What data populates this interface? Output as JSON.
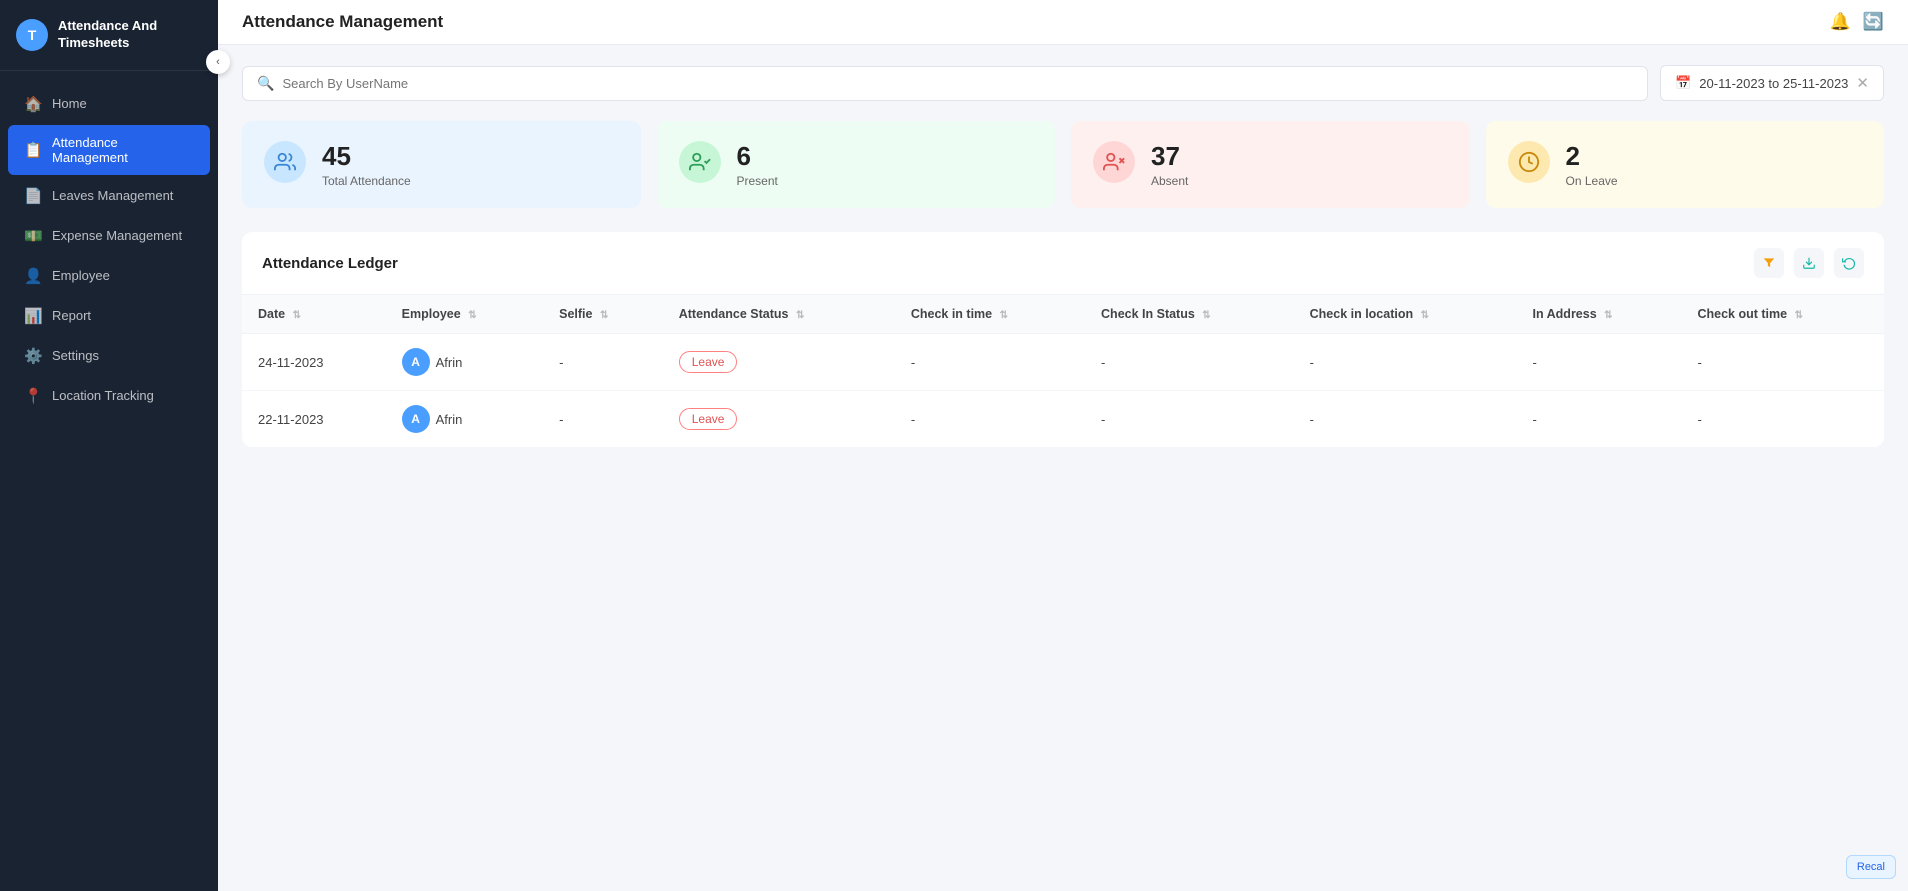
{
  "sidebar": {
    "logo_initial": "T",
    "logo_text": "Attendance And\nTimesheets",
    "items": [
      {
        "id": "home",
        "label": "Home",
        "icon": "🏠",
        "active": false
      },
      {
        "id": "attendance",
        "label": "Attendance Management",
        "icon": "📋",
        "active": true
      },
      {
        "id": "leaves",
        "label": "Leaves Management",
        "icon": "📄",
        "active": false
      },
      {
        "id": "expense",
        "label": "Expense Management",
        "icon": "💵",
        "active": false
      },
      {
        "id": "employee",
        "label": "Employee",
        "icon": "👤",
        "active": false
      },
      {
        "id": "report",
        "label": "Report",
        "icon": "📊",
        "active": false
      },
      {
        "id": "settings",
        "label": "Settings",
        "icon": "⚙️",
        "active": false
      },
      {
        "id": "location",
        "label": "Location Tracking",
        "icon": "📍",
        "active": false
      }
    ]
  },
  "header": {
    "title": "Attendance Management",
    "notification_icon": "🔔",
    "refresh_icon": "🔄"
  },
  "search": {
    "placeholder": "Search By UserName"
  },
  "date_range": {
    "value": "20-11-2023 to 25-11-2023"
  },
  "stats": [
    {
      "id": "total",
      "number": "45",
      "label": "Total Attendance",
      "color": "blue"
    },
    {
      "id": "present",
      "number": "6",
      "label": "Present",
      "color": "green"
    },
    {
      "id": "absent",
      "number": "37",
      "label": "Absent",
      "color": "red"
    },
    {
      "id": "onleave",
      "number": "2",
      "label": "On Leave",
      "color": "yellow"
    }
  ],
  "table": {
    "title": "Attendance Ledger",
    "columns": [
      "Date",
      "Employee",
      "Selfie",
      "Attendance Status",
      "Check in time",
      "Check In Status",
      "Check in location",
      "In Address",
      "Check out time"
    ],
    "rows": [
      {
        "date": "24-11-2023",
        "employee_initial": "A",
        "employee_name": "Afrin",
        "selfie": "-",
        "attendance_status": "Leave",
        "check_in_time": "-",
        "check_in_status": "-",
        "check_in_location": "-",
        "in_address": "-",
        "check_out_time": "-"
      },
      {
        "date": "22-11-2023",
        "employee_initial": "A",
        "employee_name": "Afrin",
        "selfie": "-",
        "attendance_status": "Leave",
        "check_in_time": "-",
        "check_in_status": "-",
        "check_in_location": "-",
        "in_address": "-",
        "check_out_time": "-"
      }
    ]
  },
  "recal_label": "Recal"
}
